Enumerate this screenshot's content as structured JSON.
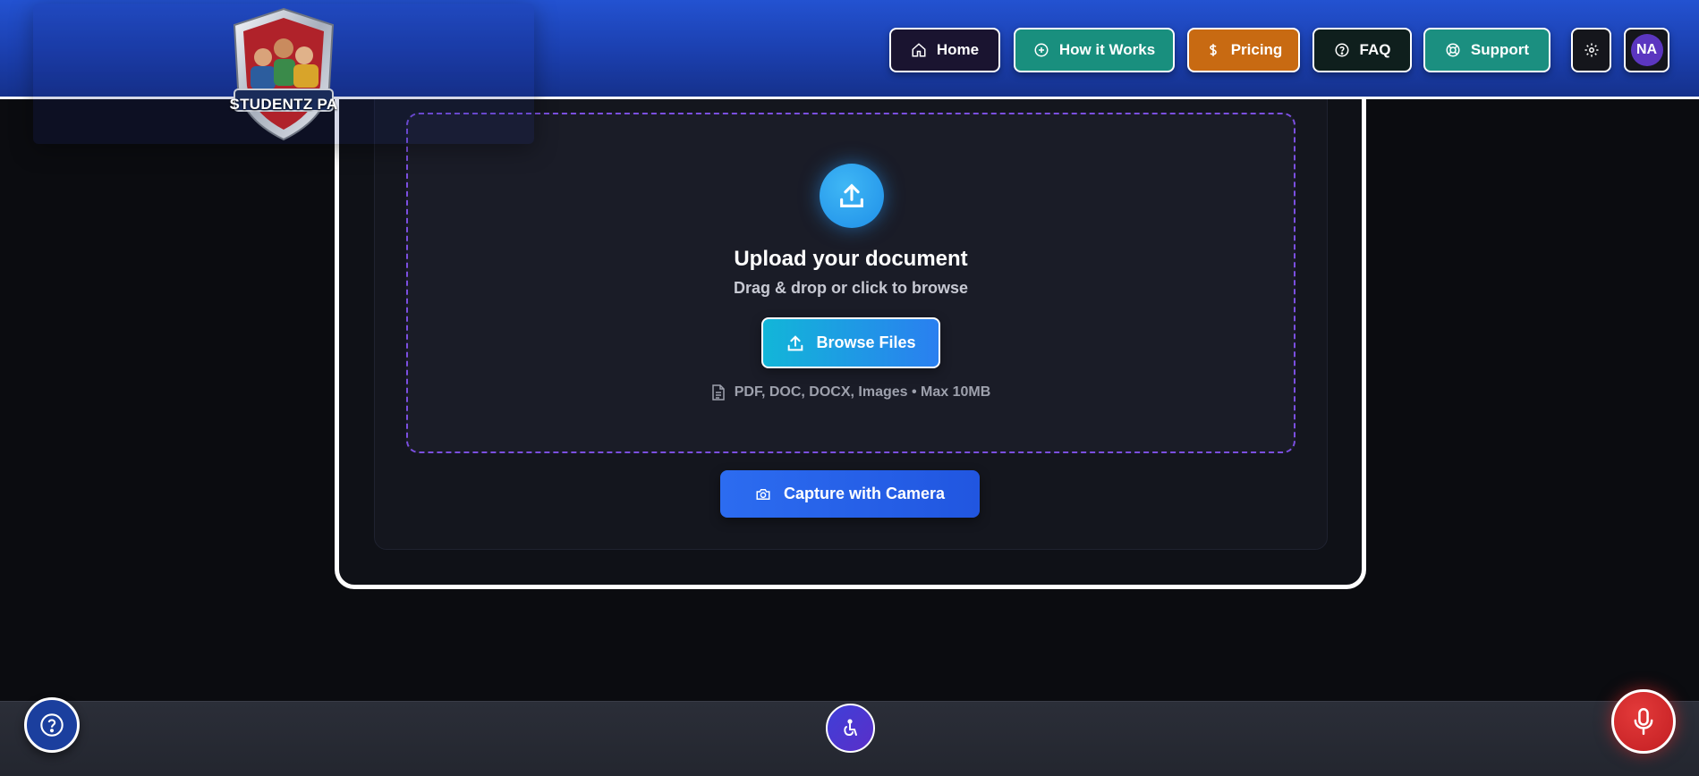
{
  "brand": {
    "logo_text": "STUDENTZ PA"
  },
  "nav": {
    "home": "Home",
    "how_it_works": "How it Works",
    "pricing": "Pricing",
    "faq": "FAQ",
    "support": "Support",
    "avatar_initials": "NA"
  },
  "upload": {
    "title": "Upload your document",
    "subtitle": "Drag & drop or click to browse",
    "browse_label": "Browse Files",
    "formats_text": "PDF, DOC, DOCX, Images • Max 10MB"
  },
  "camera": {
    "label": "Capture with Camera"
  },
  "icons": {
    "home": "home-icon",
    "how_it_works": "plus-circle-icon",
    "pricing": "dollar-icon",
    "faq": "question-circle-icon",
    "support": "lifebuoy-icon",
    "settings": "gear-icon",
    "upload": "upload-icon",
    "file": "file-icon",
    "camera": "camera-icon",
    "help": "help-icon",
    "accessibility": "accessibility-icon",
    "mic": "microphone-icon"
  },
  "colors": {
    "header_blue": "#1b3fae",
    "how_teal": "#198f7e",
    "pricing_orange": "#c86a12",
    "dashed_purple": "#7b4fe0",
    "upload_blue": "#2a7ff0",
    "mic_red": "#c21e22",
    "avatar_purple": "#5b36c0"
  }
}
